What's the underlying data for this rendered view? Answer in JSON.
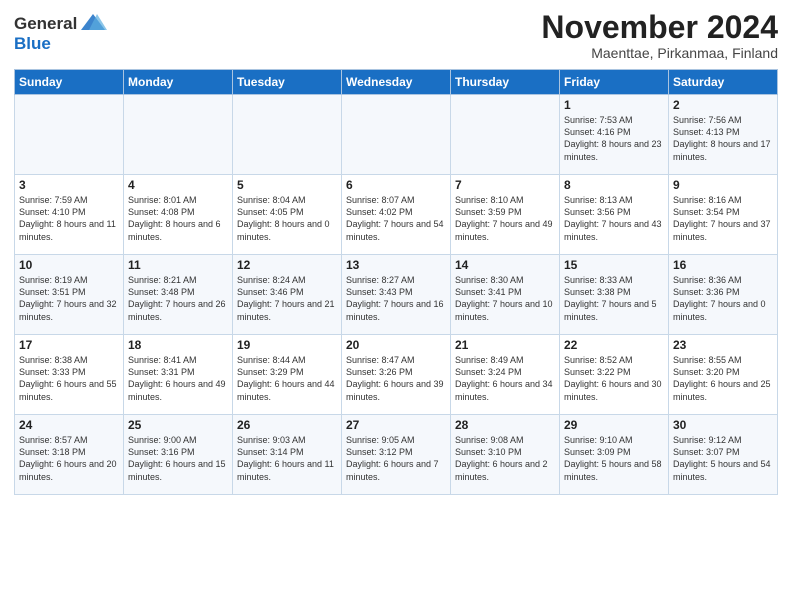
{
  "logo": {
    "general": "General",
    "blue": "Blue"
  },
  "header": {
    "month": "November 2024",
    "location": "Maenttae, Pirkanmaa, Finland"
  },
  "days_of_week": [
    "Sunday",
    "Monday",
    "Tuesday",
    "Wednesday",
    "Thursday",
    "Friday",
    "Saturday"
  ],
  "weeks": [
    [
      {
        "day": "",
        "info": ""
      },
      {
        "day": "",
        "info": ""
      },
      {
        "day": "",
        "info": ""
      },
      {
        "day": "",
        "info": ""
      },
      {
        "day": "",
        "info": ""
      },
      {
        "day": "1",
        "info": "Sunrise: 7:53 AM\nSunset: 4:16 PM\nDaylight: 8 hours\nand 23 minutes."
      },
      {
        "day": "2",
        "info": "Sunrise: 7:56 AM\nSunset: 4:13 PM\nDaylight: 8 hours\nand 17 minutes."
      }
    ],
    [
      {
        "day": "3",
        "info": "Sunrise: 7:59 AM\nSunset: 4:10 PM\nDaylight: 8 hours\nand 11 minutes."
      },
      {
        "day": "4",
        "info": "Sunrise: 8:01 AM\nSunset: 4:08 PM\nDaylight: 8 hours\nand 6 minutes."
      },
      {
        "day": "5",
        "info": "Sunrise: 8:04 AM\nSunset: 4:05 PM\nDaylight: 8 hours\nand 0 minutes."
      },
      {
        "day": "6",
        "info": "Sunrise: 8:07 AM\nSunset: 4:02 PM\nDaylight: 7 hours\nand 54 minutes."
      },
      {
        "day": "7",
        "info": "Sunrise: 8:10 AM\nSunset: 3:59 PM\nDaylight: 7 hours\nand 49 minutes."
      },
      {
        "day": "8",
        "info": "Sunrise: 8:13 AM\nSunset: 3:56 PM\nDaylight: 7 hours\nand 43 minutes."
      },
      {
        "day": "9",
        "info": "Sunrise: 8:16 AM\nSunset: 3:54 PM\nDaylight: 7 hours\nand 37 minutes."
      }
    ],
    [
      {
        "day": "10",
        "info": "Sunrise: 8:19 AM\nSunset: 3:51 PM\nDaylight: 7 hours\nand 32 minutes."
      },
      {
        "day": "11",
        "info": "Sunrise: 8:21 AM\nSunset: 3:48 PM\nDaylight: 7 hours\nand 26 minutes."
      },
      {
        "day": "12",
        "info": "Sunrise: 8:24 AM\nSunset: 3:46 PM\nDaylight: 7 hours\nand 21 minutes."
      },
      {
        "day": "13",
        "info": "Sunrise: 8:27 AM\nSunset: 3:43 PM\nDaylight: 7 hours\nand 16 minutes."
      },
      {
        "day": "14",
        "info": "Sunrise: 8:30 AM\nSunset: 3:41 PM\nDaylight: 7 hours\nand 10 minutes."
      },
      {
        "day": "15",
        "info": "Sunrise: 8:33 AM\nSunset: 3:38 PM\nDaylight: 7 hours\nand 5 minutes."
      },
      {
        "day": "16",
        "info": "Sunrise: 8:36 AM\nSunset: 3:36 PM\nDaylight: 7 hours\nand 0 minutes."
      }
    ],
    [
      {
        "day": "17",
        "info": "Sunrise: 8:38 AM\nSunset: 3:33 PM\nDaylight: 6 hours\nand 55 minutes."
      },
      {
        "day": "18",
        "info": "Sunrise: 8:41 AM\nSunset: 3:31 PM\nDaylight: 6 hours\nand 49 minutes."
      },
      {
        "day": "19",
        "info": "Sunrise: 8:44 AM\nSunset: 3:29 PM\nDaylight: 6 hours\nand 44 minutes."
      },
      {
        "day": "20",
        "info": "Sunrise: 8:47 AM\nSunset: 3:26 PM\nDaylight: 6 hours\nand 39 minutes."
      },
      {
        "day": "21",
        "info": "Sunrise: 8:49 AM\nSunset: 3:24 PM\nDaylight: 6 hours\nand 34 minutes."
      },
      {
        "day": "22",
        "info": "Sunrise: 8:52 AM\nSunset: 3:22 PM\nDaylight: 6 hours\nand 30 minutes."
      },
      {
        "day": "23",
        "info": "Sunrise: 8:55 AM\nSunset: 3:20 PM\nDaylight: 6 hours\nand 25 minutes."
      }
    ],
    [
      {
        "day": "24",
        "info": "Sunrise: 8:57 AM\nSunset: 3:18 PM\nDaylight: 6 hours\nand 20 minutes."
      },
      {
        "day": "25",
        "info": "Sunrise: 9:00 AM\nSunset: 3:16 PM\nDaylight: 6 hours\nand 15 minutes."
      },
      {
        "day": "26",
        "info": "Sunrise: 9:03 AM\nSunset: 3:14 PM\nDaylight: 6 hours\nand 11 minutes."
      },
      {
        "day": "27",
        "info": "Sunrise: 9:05 AM\nSunset: 3:12 PM\nDaylight: 6 hours\nand 7 minutes."
      },
      {
        "day": "28",
        "info": "Sunrise: 9:08 AM\nSunset: 3:10 PM\nDaylight: 6 hours\nand 2 minutes."
      },
      {
        "day": "29",
        "info": "Sunrise: 9:10 AM\nSunset: 3:09 PM\nDaylight: 5 hours\nand 58 minutes."
      },
      {
        "day": "30",
        "info": "Sunrise: 9:12 AM\nSunset: 3:07 PM\nDaylight: 5 hours\nand 54 minutes."
      }
    ]
  ]
}
